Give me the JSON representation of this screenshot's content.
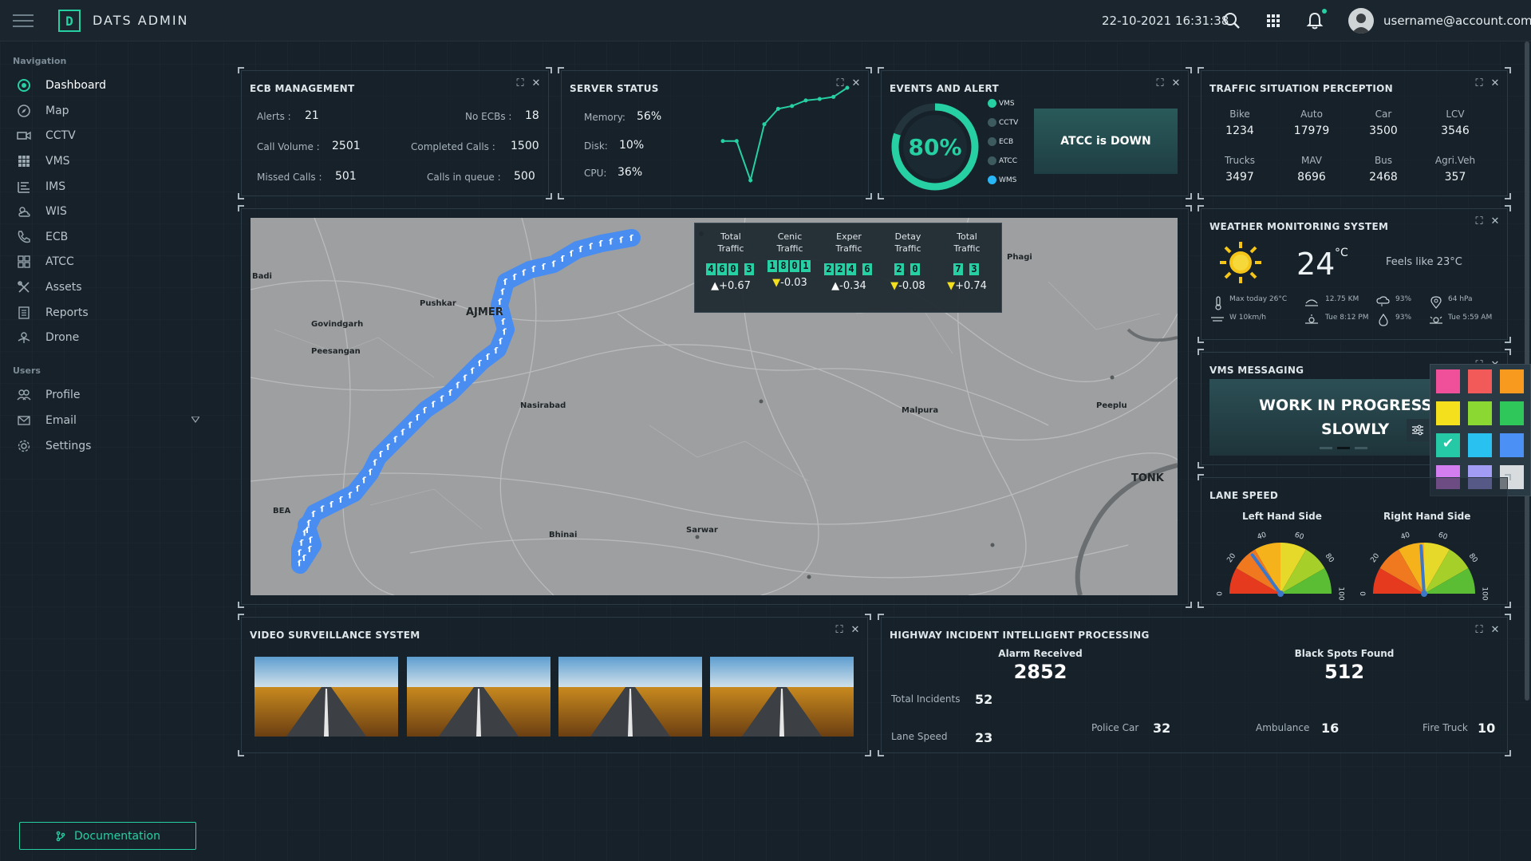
{
  "header": {
    "app_title": "DATS ADMIN",
    "logo_letter": "D",
    "datetime": "22-10-2021 16:31:38",
    "user": "username@account.com"
  },
  "sidebar": {
    "nav_title": "Navigation",
    "nav_items": [
      {
        "label": "Dashboard",
        "icon": "dashboard-icon",
        "active": true
      },
      {
        "label": "Map",
        "icon": "compass-icon"
      },
      {
        "label": "CCTV",
        "icon": "camera-icon"
      },
      {
        "label": "VMS",
        "icon": "grid-icon"
      },
      {
        "label": "IMS",
        "icon": "list-icon"
      },
      {
        "label": "WIS",
        "icon": "weather-icon"
      },
      {
        "label": "ECB",
        "icon": "phone-icon"
      },
      {
        "label": "ATCC",
        "icon": "blocks-icon"
      },
      {
        "label": "Assets",
        "icon": "tools-icon"
      },
      {
        "label": "Reports",
        "icon": "report-icon"
      },
      {
        "label": "Drone",
        "icon": "drone-icon"
      }
    ],
    "users_title": "Users",
    "user_items": [
      {
        "label": "Profile",
        "icon": "users-icon"
      },
      {
        "label": "Email",
        "icon": "mail-icon"
      },
      {
        "label": "Settings",
        "icon": "gear-icon"
      }
    ],
    "doc_button": "Documentation"
  },
  "ecb": {
    "title": "ECB MANAGEMENT",
    "alerts_label": "Alerts :",
    "alerts": "21",
    "no_ecbs_label": "No ECBs :",
    "no_ecbs": "18",
    "call_volume_label": "Call Volume :",
    "call_volume": "2501",
    "completed_label": "Completed Calls :",
    "completed": "1500",
    "missed_label": "Missed Calls :",
    "missed": "501",
    "queue_label": "Calls in queue :",
    "queue": "500"
  },
  "server": {
    "title": "SERVER STATUS",
    "memory_label": "Memory:",
    "memory": "56%",
    "disk_label": "Disk:",
    "disk": "10%",
    "cpu_label": "CPU:",
    "cpu": "36%",
    "sparkline": [
      62,
      62,
      6,
      86,
      108,
      112,
      120,
      122,
      125,
      138
    ]
  },
  "events": {
    "title": "EVENTS AND ALERT",
    "percent": "80%",
    "percent_value": 0.8,
    "legend": [
      {
        "label": "VMS",
        "color": "#26d0a3"
      },
      {
        "label": "CCTV",
        "color": "#3d5a5f"
      },
      {
        "label": "ECB",
        "color": "#3d5a5f"
      },
      {
        "label": "ATCC",
        "color": "#3d5a5f"
      },
      {
        "label": "WMS",
        "color": "#29b6f6"
      }
    ],
    "alert_text": "ATCC is DOWN"
  },
  "traffic_perception": {
    "title": "TRAFFIC SITUATION PERCEPTION",
    "row1": [
      {
        "label": "Bike",
        "value": "1234"
      },
      {
        "label": "Auto",
        "value": "17979"
      },
      {
        "label": "Car",
        "value": "3500"
      },
      {
        "label": "LCV",
        "value": "3546"
      }
    ],
    "row2": [
      {
        "label": "Trucks",
        "value": "3497"
      },
      {
        "label": "MAV",
        "value": "8696"
      },
      {
        "label": "Bus",
        "value": "2468"
      },
      {
        "label": "Agri.Veh",
        "value": "357"
      }
    ]
  },
  "map": {
    "places": [
      {
        "name": "Badi"
      },
      {
        "name": "Pushkar"
      },
      {
        "name": "AJMER"
      },
      {
        "name": "Govindgarh"
      },
      {
        "name": "Peesangan"
      },
      {
        "name": "Nasirabad"
      },
      {
        "name": "Malpura"
      },
      {
        "name": "Peeplu"
      },
      {
        "name": "TONK"
      },
      {
        "name": "BEA"
      },
      {
        "name": "Bhinai"
      },
      {
        "name": "Sarwar"
      },
      {
        "name": "Phagi"
      }
    ],
    "counters": [
      {
        "label1": "Total",
        "label2": "Traffic",
        "digits": "460 3",
        "delta": "+0.67",
        "dir": "up"
      },
      {
        "label1": "Cenic",
        "label2": "Traffic",
        "digits": "1801",
        "delta": "-0.03",
        "dir": "down"
      },
      {
        "label1": "Exper",
        "label2": "Traffic",
        "digits": "224 6",
        "delta": "-0.34",
        "dir": "up"
      },
      {
        "label1": "Detay",
        "label2": "Traffic",
        "digits": "2 0",
        "delta": "-0.08",
        "dir": "down"
      },
      {
        "label1": "Total",
        "label2": "Traffic",
        "digits": "7 3",
        "delta": "+0.74",
        "dir": "down"
      }
    ]
  },
  "weather": {
    "title": "WEATHER MONITORING SYSTEM",
    "temp": "24",
    "unit": "°C",
    "feels": "Feels like 23°C",
    "max_today": "Max today 26°C",
    "wind": "W 10km/h",
    "visibility": "12.75 KM",
    "sunset": "Tue 8:12 PM",
    "humidity1": "93%",
    "humidity2": "93%",
    "pressure": "64 hPa",
    "sunrise": "Tue 5:59 AM"
  },
  "vms": {
    "title": "VMS MESSAGING",
    "line1": "WORK IN PROGRESS G",
    "line2": "SLOWLY",
    "swatches": [
      "#f0509a",
      "#f25a5a",
      "#f79a1e",
      "#f4e01c",
      "#8bd832",
      "#2fc75a",
      "#26c9a6",
      "#29c2f0",
      "#4a90f5",
      "#d27ef0",
      "#a39cf5",
      "#d9dcdf"
    ],
    "selected_swatch": 6
  },
  "lane_speed": {
    "title": "LANE SPEED",
    "left_label": "Left Hand Side",
    "right_label": "Right Hand Side",
    "ticks": [
      "0",
      "20",
      "40",
      "60",
      "80",
      "100"
    ],
    "left_value": 30,
    "right_value": 48
  },
  "video": {
    "title": "VIDEO SURVEILLANCE SYSTEM"
  },
  "incident": {
    "title": "HIGHWAY INCIDENT INTELLIGENT PROCESSING",
    "alarm_label": "Alarm Received",
    "alarm": "2852",
    "blackspot_label": "Black Spots Found",
    "blackspot": "512",
    "total_label": "Total Incidents",
    "total": "52",
    "lane_label": "Lane Speed",
    "lane": "23",
    "police_label": "Police Car",
    "police": "32",
    "ambulance_label": "Ambulance",
    "ambulance": "16",
    "fire_label": "Fire Truck",
    "fire": "10"
  },
  "colors": {
    "accent": "#26d0a3",
    "background": "#16212a",
    "route": "#4a8df0"
  }
}
